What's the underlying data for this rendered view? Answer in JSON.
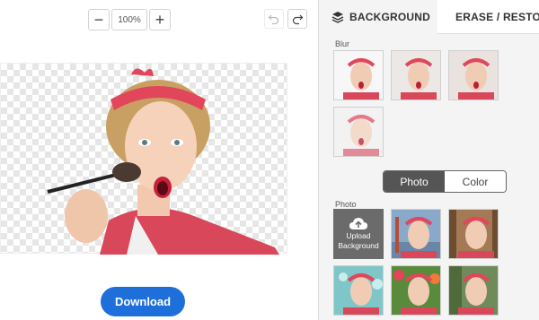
{
  "zoom": {
    "minus": "−",
    "value": "100%",
    "plus": "+"
  },
  "actions": {
    "download_label": "Download"
  },
  "panel": {
    "tabs": [
      {
        "label": "BACKGROUND",
        "icon": "layers-icon",
        "active": true
      },
      {
        "label": "ERASE / RESTO",
        "icon": "brush-icon",
        "active": false
      }
    ],
    "blur_label": "Blur",
    "toggle": {
      "photo": "Photo",
      "color": "Color",
      "selected": "Photo"
    },
    "photo_label": "Photo",
    "upload_label_1": "Upload",
    "upload_label_2": "Background"
  },
  "colors": {
    "accent": "#1e6fd9",
    "panel_bg": "#f4f4f4",
    "toggle_on": "#555555"
  }
}
